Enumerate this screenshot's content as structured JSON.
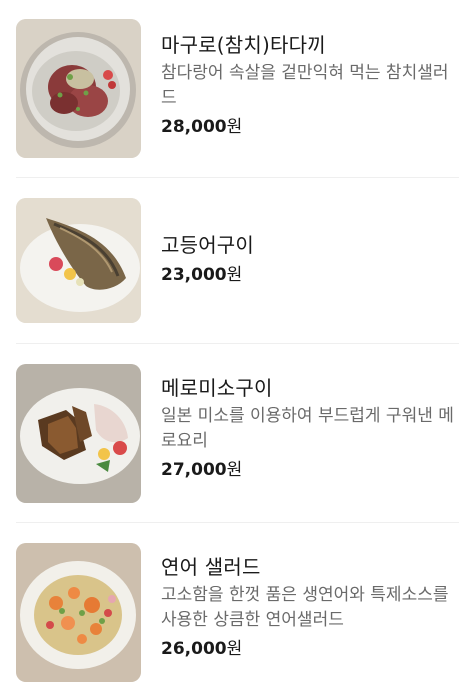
{
  "menu": {
    "items": [
      {
        "name": "마구로(참치)타다끼",
        "description": "참다랑어 속살을 겉만익혀 먹는 참치샐러드",
        "price": "28,000",
        "currency": "원",
        "image_icon": "tuna-tataki-photo"
      },
      {
        "name": "고등어구이",
        "description": "",
        "price": "23,000",
        "currency": "원",
        "image_icon": "grilled-mackerel-photo"
      },
      {
        "name": "메로미소구이",
        "description": "일본 미소를 이용하여 부드럽게 구워낸 메로요리",
        "price": "27,000",
        "currency": "원",
        "image_icon": "miso-mero-photo"
      },
      {
        "name": "연어 샐러드",
        "description": "고소함을 한껏 품은 생연어와 특제소스를 사용한 상큼한 연어샐러드",
        "price": "26,000",
        "currency": "원",
        "image_icon": "salmon-salad-photo"
      }
    ]
  }
}
